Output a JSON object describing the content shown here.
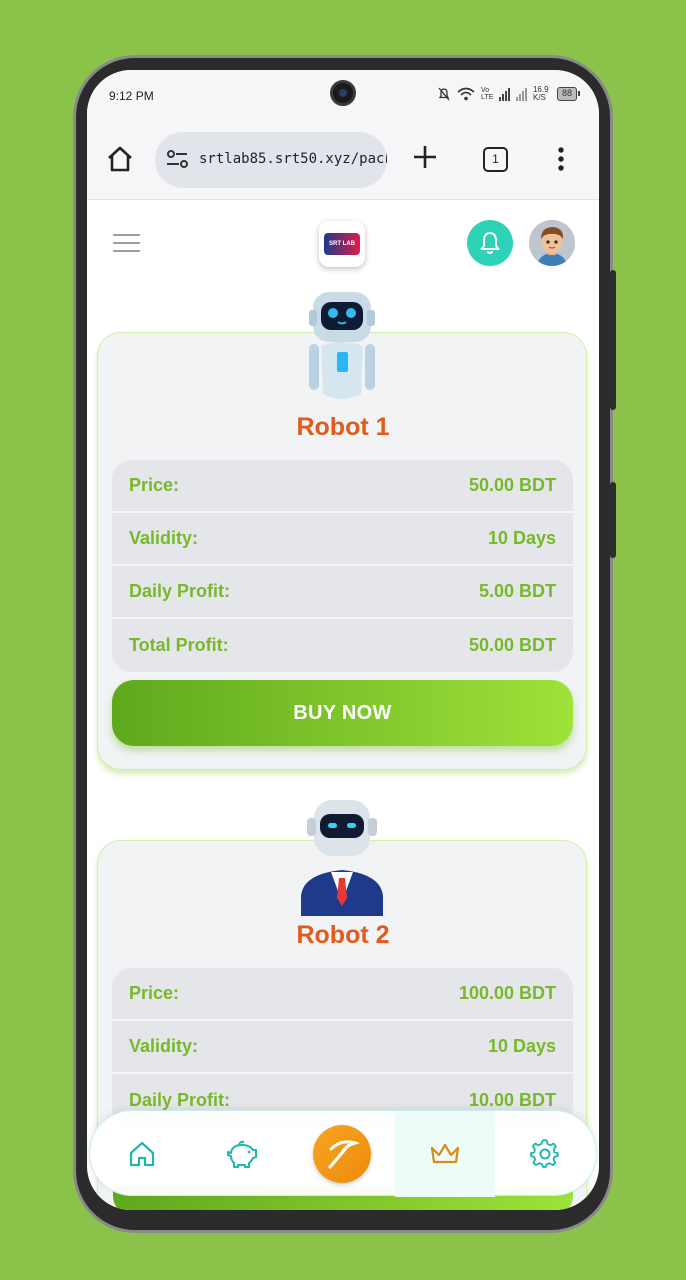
{
  "status_bar": {
    "time": "9:12 PM",
    "network": "Vo LTE",
    "speed": "16.9 K/S",
    "battery": "88"
  },
  "browser": {
    "url": "srtlab85.srt50.xyz/packag",
    "tab_count": "1"
  },
  "header": {
    "logo_text": "SRT LAB"
  },
  "packages": [
    {
      "name": "Robot 1",
      "rows": [
        {
          "label": "Price:",
          "value": "50.00 BDT"
        },
        {
          "label": "Validity:",
          "value": "10 Days"
        },
        {
          "label": "Daily Profit:",
          "value": "5.00 BDT"
        },
        {
          "label": "Total Profit:",
          "value": "50.00 BDT"
        }
      ],
      "button": "BUY NOW"
    },
    {
      "name": "Robot 2",
      "rows": [
        {
          "label": "Price:",
          "value": "100.00 BDT"
        },
        {
          "label": "Validity:",
          "value": "10 Days"
        },
        {
          "label": "Daily Profit:",
          "value": "10.00 BDT"
        }
      ]
    }
  ],
  "bottom_nav": [
    {
      "icon": "home-icon"
    },
    {
      "icon": "piggy-bank-icon"
    },
    {
      "icon": "pickaxe-icon"
    },
    {
      "icon": "crown-icon",
      "active": true
    },
    {
      "icon": "gear-icon"
    }
  ],
  "colors": {
    "background": "#8bc34a",
    "accent_green": "#78b82a",
    "title_orange": "#e25a1c",
    "teal": "#2ed3b7"
  }
}
